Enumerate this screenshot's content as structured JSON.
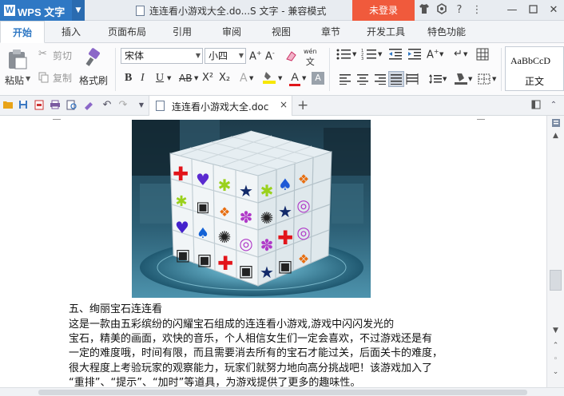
{
  "titlebar": {
    "app_logo": "W",
    "app_name": "WPS 文字",
    "doc_title": "连连看小游戏大全.do...S 文字 - 兼容模式",
    "login_label": "未登录",
    "icons": [
      "shirt-icon",
      "brand-icon",
      "help-icon",
      "more-icon"
    ],
    "help_label": "?",
    "controls": [
      "minimize-icon",
      "maximize-icon",
      "close-icon"
    ]
  },
  "menu": {
    "tabs": [
      "开始",
      "插入",
      "页面布局",
      "引用",
      "审阅",
      "视图",
      "章节",
      "开发工具",
      "特色功能"
    ],
    "active_tab": "开始"
  },
  "ribbon": {
    "paste": "粘贴",
    "cut": "剪切",
    "copy": "复制",
    "format_painter": "格式刷",
    "font_name": "宋体",
    "font_size": "小四",
    "bold": "B",
    "italic": "I",
    "underline": "U",
    "strikethrough": "AB",
    "superscript": "X²",
    "subscript": "X₂",
    "font_color_letter": "A",
    "style_sample": "AaBbCcD",
    "style_name": "正文",
    "accent_color": "#2f78c4",
    "font_color": "#e0161a",
    "highlight_color": "#f7e700"
  },
  "quickbar": {
    "doc_tab_label": "连连看小游戏大全.doc",
    "close_label": "×",
    "new_tab_label": "+"
  },
  "document": {
    "heading": "五、绚丽宝石连连看",
    "lines": [
      "        这是一款由五彩缤纷的闪耀宝石组成的连连看小游戏,游戏中闪闪发光的",
      "宝石，精美的画面，欢快的音乐，个人相信女生们一定会喜欢，不过游戏还是有",
      "一定的难度哦，时间有限，而且需要消去所有的宝石才能过关，后面关卡的难度，",
      "很大程度上考验玩家的观察能力，玩家们就努力地向高分挑战吧！该游戏加入了",
      "“重排”、“提示”、“加时”等道具，为游戏提供了更多的趣味性。"
    ]
  }
}
